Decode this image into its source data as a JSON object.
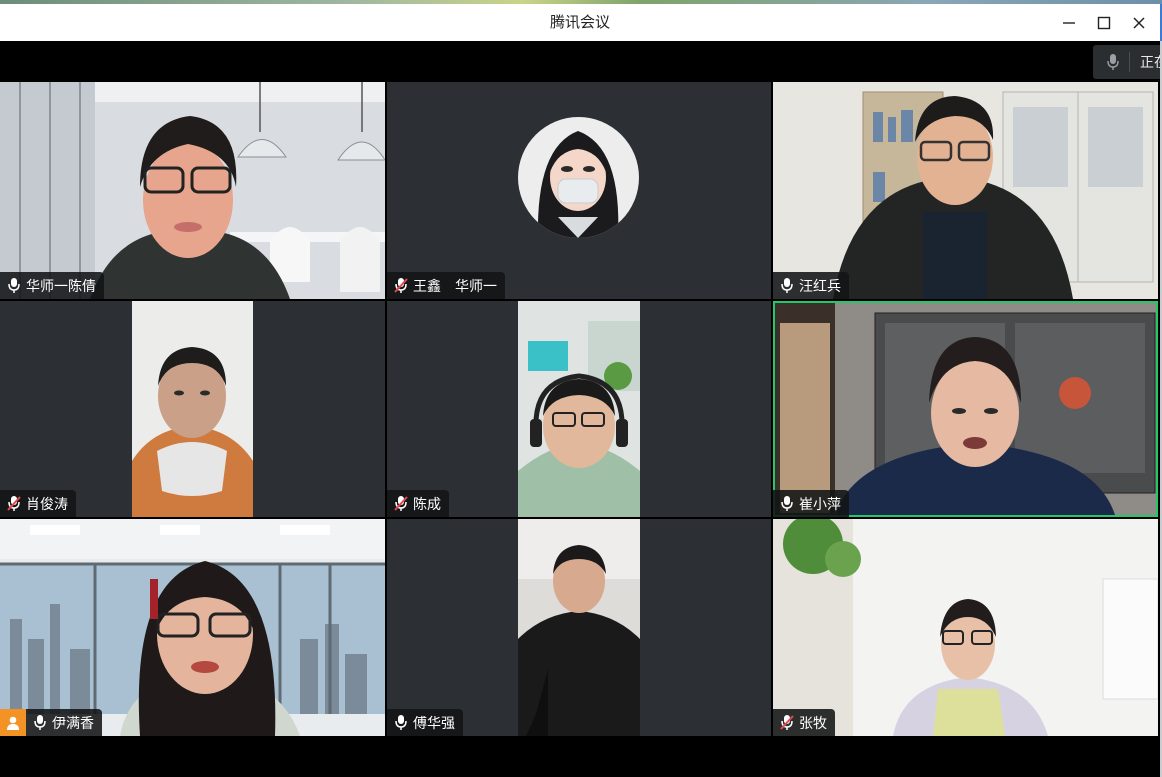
{
  "window": {
    "title": "腾讯会议",
    "minimize_glyph": "—",
    "maximize_glyph": "☐",
    "close_glyph": "✕"
  },
  "speaking_indicator": {
    "text": "正在"
  },
  "participants": [
    {
      "name": "华师一陈倩",
      "mic": "on"
    },
    {
      "name": "王鑫　华师一",
      "mic": "muted"
    },
    {
      "name": "汪红兵",
      "mic": "on"
    },
    {
      "name": "肖俊涛",
      "mic": "muted"
    },
    {
      "name": "陈成",
      "mic": "muted"
    },
    {
      "name": "崔小萍",
      "mic": "on",
      "active_speaker": true
    },
    {
      "name": "伊满香",
      "mic": "on",
      "host": true
    },
    {
      "name": "傅华强",
      "mic": "on"
    },
    {
      "name": "张牧",
      "mic": "muted"
    }
  ],
  "colors": {
    "tile_bg": "#2c2f33",
    "active_border": "#24c76a",
    "host_badge": "#f39325",
    "muted_red": "#e5484d"
  }
}
